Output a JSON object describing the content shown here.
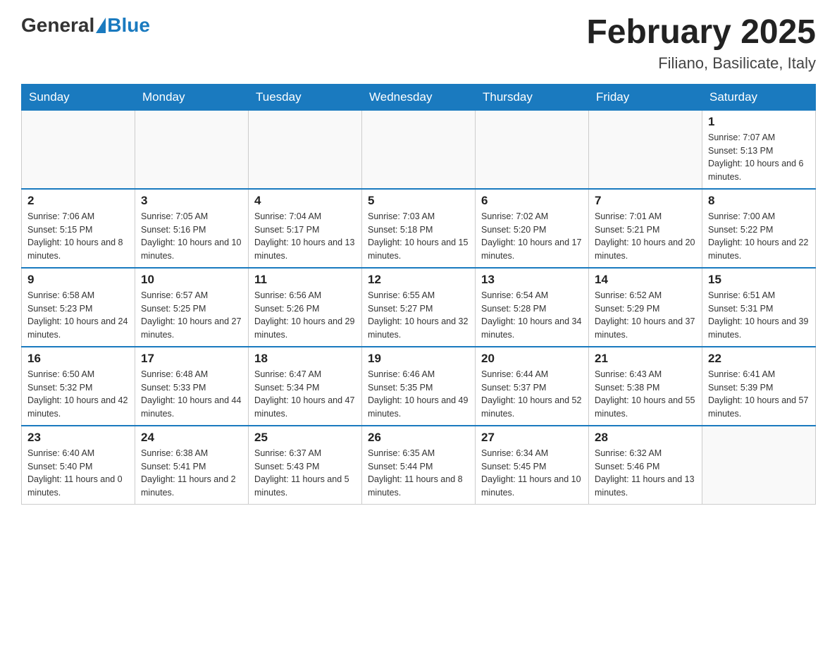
{
  "header": {
    "logo_general": "General",
    "logo_blue": "Blue",
    "month_title": "February 2025",
    "location": "Filiano, Basilicate, Italy"
  },
  "days_of_week": [
    "Sunday",
    "Monday",
    "Tuesday",
    "Wednesday",
    "Thursday",
    "Friday",
    "Saturday"
  ],
  "weeks": [
    [
      null,
      null,
      null,
      null,
      null,
      null,
      {
        "day": "1",
        "sunrise": "Sunrise: 7:07 AM",
        "sunset": "Sunset: 5:13 PM",
        "daylight": "Daylight: 10 hours and 6 minutes."
      }
    ],
    [
      {
        "day": "2",
        "sunrise": "Sunrise: 7:06 AM",
        "sunset": "Sunset: 5:15 PM",
        "daylight": "Daylight: 10 hours and 8 minutes."
      },
      {
        "day": "3",
        "sunrise": "Sunrise: 7:05 AM",
        "sunset": "Sunset: 5:16 PM",
        "daylight": "Daylight: 10 hours and 10 minutes."
      },
      {
        "day": "4",
        "sunrise": "Sunrise: 7:04 AM",
        "sunset": "Sunset: 5:17 PM",
        "daylight": "Daylight: 10 hours and 13 minutes."
      },
      {
        "day": "5",
        "sunrise": "Sunrise: 7:03 AM",
        "sunset": "Sunset: 5:18 PM",
        "daylight": "Daylight: 10 hours and 15 minutes."
      },
      {
        "day": "6",
        "sunrise": "Sunrise: 7:02 AM",
        "sunset": "Sunset: 5:20 PM",
        "daylight": "Daylight: 10 hours and 17 minutes."
      },
      {
        "day": "7",
        "sunrise": "Sunrise: 7:01 AM",
        "sunset": "Sunset: 5:21 PM",
        "daylight": "Daylight: 10 hours and 20 minutes."
      },
      {
        "day": "8",
        "sunrise": "Sunrise: 7:00 AM",
        "sunset": "Sunset: 5:22 PM",
        "daylight": "Daylight: 10 hours and 22 minutes."
      }
    ],
    [
      {
        "day": "9",
        "sunrise": "Sunrise: 6:58 AM",
        "sunset": "Sunset: 5:23 PM",
        "daylight": "Daylight: 10 hours and 24 minutes."
      },
      {
        "day": "10",
        "sunrise": "Sunrise: 6:57 AM",
        "sunset": "Sunset: 5:25 PM",
        "daylight": "Daylight: 10 hours and 27 minutes."
      },
      {
        "day": "11",
        "sunrise": "Sunrise: 6:56 AM",
        "sunset": "Sunset: 5:26 PM",
        "daylight": "Daylight: 10 hours and 29 minutes."
      },
      {
        "day": "12",
        "sunrise": "Sunrise: 6:55 AM",
        "sunset": "Sunset: 5:27 PM",
        "daylight": "Daylight: 10 hours and 32 minutes."
      },
      {
        "day": "13",
        "sunrise": "Sunrise: 6:54 AM",
        "sunset": "Sunset: 5:28 PM",
        "daylight": "Daylight: 10 hours and 34 minutes."
      },
      {
        "day": "14",
        "sunrise": "Sunrise: 6:52 AM",
        "sunset": "Sunset: 5:29 PM",
        "daylight": "Daylight: 10 hours and 37 minutes."
      },
      {
        "day": "15",
        "sunrise": "Sunrise: 6:51 AM",
        "sunset": "Sunset: 5:31 PM",
        "daylight": "Daylight: 10 hours and 39 minutes."
      }
    ],
    [
      {
        "day": "16",
        "sunrise": "Sunrise: 6:50 AM",
        "sunset": "Sunset: 5:32 PM",
        "daylight": "Daylight: 10 hours and 42 minutes."
      },
      {
        "day": "17",
        "sunrise": "Sunrise: 6:48 AM",
        "sunset": "Sunset: 5:33 PM",
        "daylight": "Daylight: 10 hours and 44 minutes."
      },
      {
        "day": "18",
        "sunrise": "Sunrise: 6:47 AM",
        "sunset": "Sunset: 5:34 PM",
        "daylight": "Daylight: 10 hours and 47 minutes."
      },
      {
        "day": "19",
        "sunrise": "Sunrise: 6:46 AM",
        "sunset": "Sunset: 5:35 PM",
        "daylight": "Daylight: 10 hours and 49 minutes."
      },
      {
        "day": "20",
        "sunrise": "Sunrise: 6:44 AM",
        "sunset": "Sunset: 5:37 PM",
        "daylight": "Daylight: 10 hours and 52 minutes."
      },
      {
        "day": "21",
        "sunrise": "Sunrise: 6:43 AM",
        "sunset": "Sunset: 5:38 PM",
        "daylight": "Daylight: 10 hours and 55 minutes."
      },
      {
        "day": "22",
        "sunrise": "Sunrise: 6:41 AM",
        "sunset": "Sunset: 5:39 PM",
        "daylight": "Daylight: 10 hours and 57 minutes."
      }
    ],
    [
      {
        "day": "23",
        "sunrise": "Sunrise: 6:40 AM",
        "sunset": "Sunset: 5:40 PM",
        "daylight": "Daylight: 11 hours and 0 minutes."
      },
      {
        "day": "24",
        "sunrise": "Sunrise: 6:38 AM",
        "sunset": "Sunset: 5:41 PM",
        "daylight": "Daylight: 11 hours and 2 minutes."
      },
      {
        "day": "25",
        "sunrise": "Sunrise: 6:37 AM",
        "sunset": "Sunset: 5:43 PM",
        "daylight": "Daylight: 11 hours and 5 minutes."
      },
      {
        "day": "26",
        "sunrise": "Sunrise: 6:35 AM",
        "sunset": "Sunset: 5:44 PM",
        "daylight": "Daylight: 11 hours and 8 minutes."
      },
      {
        "day": "27",
        "sunrise": "Sunrise: 6:34 AM",
        "sunset": "Sunset: 5:45 PM",
        "daylight": "Daylight: 11 hours and 10 minutes."
      },
      {
        "day": "28",
        "sunrise": "Sunrise: 6:32 AM",
        "sunset": "Sunset: 5:46 PM",
        "daylight": "Daylight: 11 hours and 13 minutes."
      },
      null
    ]
  ]
}
